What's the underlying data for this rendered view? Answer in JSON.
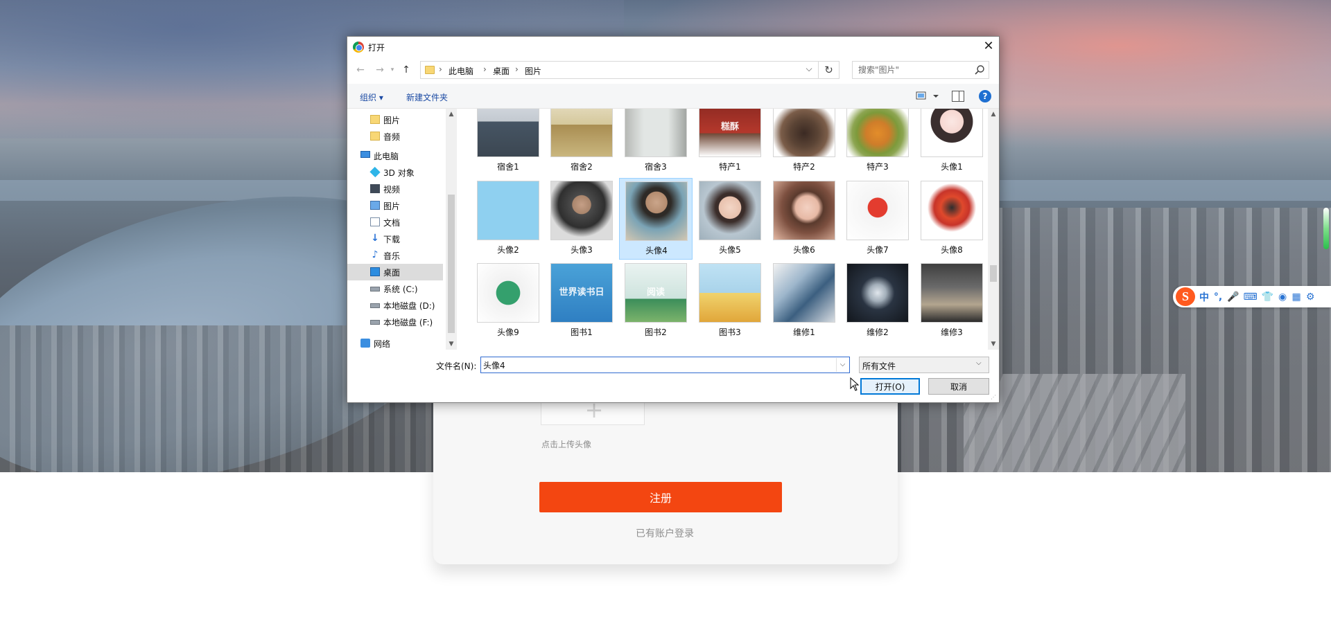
{
  "dialog": {
    "title": "打开",
    "close_icon": "close-icon",
    "address": {
      "crumbs": [
        "此电脑",
        "桌面",
        "图片"
      ]
    },
    "search_placeholder": "搜索\"图片\"",
    "commands": {
      "organize": "组织 ▾",
      "new_folder": "新建文件夹"
    },
    "help_label": "?",
    "tree": [
      {
        "label": "图片",
        "icon": "folder-icon"
      },
      {
        "label": "音频",
        "icon": "folder-icon"
      },
      {
        "label": "此电脑",
        "icon": "computer-icon"
      },
      {
        "label": "3D 对象",
        "icon": "3d-objects-icon"
      },
      {
        "label": "视频",
        "icon": "video-icon"
      },
      {
        "label": "图片",
        "icon": "pictures-icon"
      },
      {
        "label": "文档",
        "icon": "documents-icon"
      },
      {
        "label": "下载",
        "icon": "download-icon"
      },
      {
        "label": "音乐",
        "icon": "music-icon"
      },
      {
        "label": "桌面",
        "icon": "desktop-icon",
        "selected": true
      },
      {
        "label": "系统 (C:)",
        "icon": "drive-icon"
      },
      {
        "label": "本地磁盘 (D:)",
        "icon": "drive-icon"
      },
      {
        "label": "本地磁盘 (F:)",
        "icon": "drive-icon"
      },
      {
        "label": "网络",
        "icon": "network-icon"
      }
    ],
    "files": [
      {
        "name": "宿舍1",
        "style": "t-room1"
      },
      {
        "name": "宿舍2",
        "style": "t-room2"
      },
      {
        "name": "宿舍3",
        "style": "t-room3"
      },
      {
        "name": "特产1",
        "style": "t-sp1",
        "overlay": "糕酥"
      },
      {
        "name": "特产2",
        "style": "t-sp2"
      },
      {
        "name": "特产3",
        "style": "t-sp3"
      },
      {
        "name": "头像1",
        "style": "t-av1"
      },
      {
        "name": "头像2",
        "style": "t-av2"
      },
      {
        "name": "头像3",
        "style": "t-av3"
      },
      {
        "name": "头像4",
        "style": "t-av4",
        "selected": true
      },
      {
        "name": "头像5",
        "style": "t-av5"
      },
      {
        "name": "头像6",
        "style": "t-av6"
      },
      {
        "name": "头像7",
        "style": "t-av7"
      },
      {
        "name": "头像8",
        "style": "t-av8"
      },
      {
        "name": "头像9",
        "style": "t-av9"
      },
      {
        "name": "图书1",
        "style": "t-book1",
        "overlay": "世界读书日"
      },
      {
        "name": "图书2",
        "style": "t-book2",
        "overlay": "阅读"
      },
      {
        "name": "图书3",
        "style": "t-book3"
      },
      {
        "name": "维修1",
        "style": "t-fix1"
      },
      {
        "name": "维修2",
        "style": "t-fix2"
      },
      {
        "name": "维修3",
        "style": "t-fix3"
      }
    ],
    "filename_label": "文件名(N):",
    "filename_value": "头像4",
    "filetype_value": "所有文件",
    "open_label": "打开(O)",
    "cancel_label": "取消"
  },
  "register": {
    "upload_hint": "点击上传头像",
    "upload_plus": "+",
    "submit_label": "注册",
    "login_link": "已有账户登录"
  },
  "ime": {
    "logo": "S",
    "items": [
      "中",
      "°,",
      "🎤",
      "⌨",
      "👕",
      "◉",
      "▦",
      "⚙"
    ]
  },
  "colors": {
    "accent_orange": "#f34611",
    "dialog_selection": "#cce8ff",
    "primary_blue": "#0078d7"
  }
}
